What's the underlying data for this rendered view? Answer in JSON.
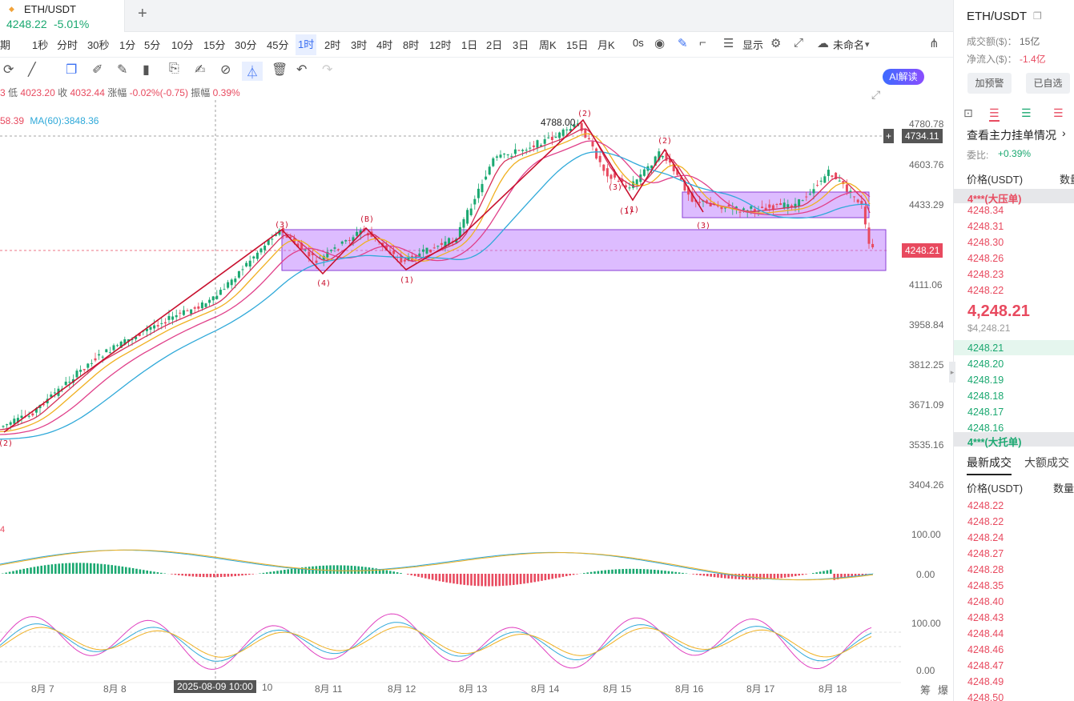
{
  "tab": {
    "symbol": "ETH/USDT",
    "price": "4248.22",
    "change": "-5.01%",
    "add": "+"
  },
  "timeframes": [
    "期",
    "1秒",
    "分时",
    "30秒",
    "1分",
    "5分",
    "10分",
    "15分",
    "30分",
    "45分",
    "1时",
    "2时",
    "3时",
    "4时",
    "8时",
    "12时",
    "1日",
    "2日",
    "3日",
    "周K",
    "15日",
    "月K",
    "0s"
  ],
  "active_tf": "1时",
  "toolbar": {
    "display": "显示",
    "layout": "未命名",
    "ai": "AI解读"
  },
  "ohlc": {
    "prefix": "3",
    "low_label": "低",
    "low": "4023.20",
    "close_label": "收",
    "close": "4032.44",
    "chg_label": "涨幅",
    "chg": "-0.02%(-0.75)",
    "amp_label": "振幅",
    "amp": "0.39%"
  },
  "ma": {
    "prefix": "58.39",
    "ma60": "MA(60):3848.36"
  },
  "yaxis": [
    "4780.78",
    "4603.76",
    "4433.29",
    "4111.06",
    "3958.84",
    "3812.25",
    "3671.09",
    "3535.16",
    "3404.26"
  ],
  "macd_axis": [
    "100.00",
    "0.00"
  ],
  "kdj_axis": [
    "100.00",
    "0.00"
  ],
  "xaxis": [
    "8月 7",
    "8月 8",
    "10",
    "8月 11",
    "8月 12",
    "8月 13",
    "8月 14",
    "8月 15",
    "8月 16",
    "8月 17",
    "8月 18"
  ],
  "crosshair_time": "2025-08-09 10:00",
  "crosshair_price": "4734.11",
  "current_price": "4248.21",
  "high_label": "4788.00",
  "wave_labels": [
    "(2)",
    "(3)",
    "(4)",
    "(B)",
    "(1)",
    "(2)",
    "(3)",
    "(1)",
    "(2)",
    "(3)",
    "(1)"
  ],
  "bottom_labels": [
    "筹",
    "爆"
  ],
  "sidebar": {
    "symbol": "ETH/USDT",
    "volume_label": "成交额($)：",
    "volume": "15亿",
    "inflow_label": "净流入($)：",
    "inflow": "-1.4亿",
    "alert_btn": "加预警",
    "fav_btn": "已自选",
    "depth_link": "查看主力挂单情况",
    "ratio_label": "委比:",
    "ratio": "+0.39%",
    "price_col": "价格(USDT)",
    "qty_col": "数量",
    "ask_big": "4***(大压单)",
    "asks": [
      "4248.34",
      "4248.31",
      "4248.30",
      "4248.26",
      "4248.23",
      "4248.22"
    ],
    "last_price": "4,248.21",
    "last_usd": "$4,248.21",
    "bids": [
      "4248.21",
      "4248.20",
      "4248.19",
      "4248.18",
      "4248.17",
      "4248.16"
    ],
    "bid_big": "4***(大托单)",
    "trades_tab": "最新成交",
    "large_tab": "大额成交",
    "trades": [
      "4248.22",
      "4248.22",
      "4248.24",
      "4248.27",
      "4248.28",
      "4248.35",
      "4248.40",
      "4248.43",
      "4248.44",
      "4248.46",
      "4248.47",
      "4248.49",
      "4248.50"
    ]
  },
  "colors": {
    "up": "#1aa870",
    "down": "#e84a5f",
    "accent": "#3a6ff2",
    "box": "#b36bff"
  }
}
